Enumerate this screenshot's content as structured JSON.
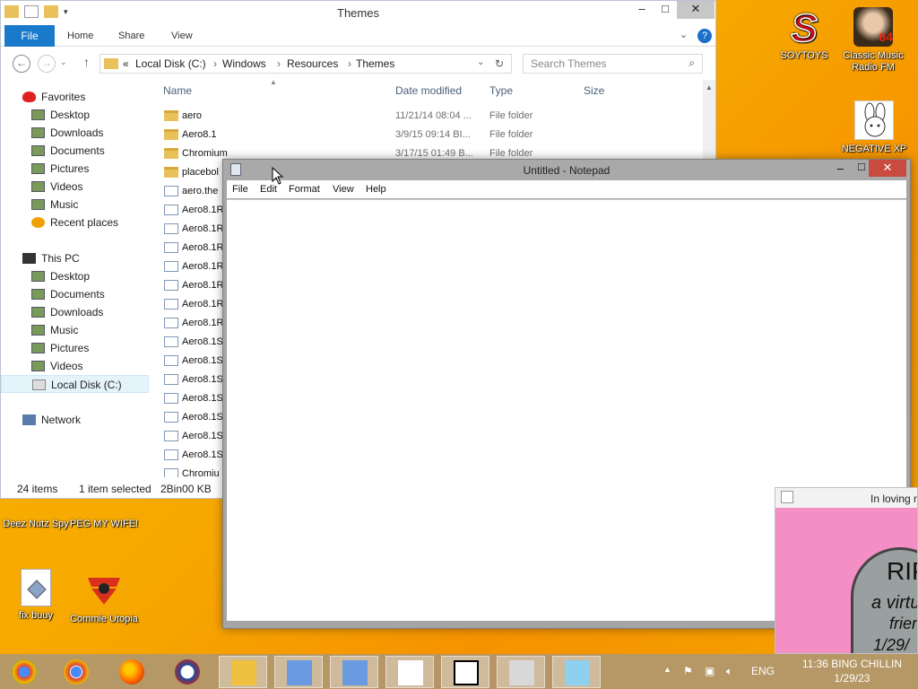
{
  "desktop_icons": [
    {
      "label": "SOYTOYS",
      "icon": "soytoys-s-icon"
    },
    {
      "label": "Classic Music Radio FM",
      "icon": "portrait-icon",
      "badge": "64"
    },
    {
      "label": "NEGATIVE XP",
      "icon": "bunny-icon"
    },
    {
      "label": "Deez Nutz Spy",
      "icon": "app-icon"
    },
    {
      "label": "PEG MY WIFE!",
      "icon": "app-icon"
    },
    {
      "label": "fix buuy",
      "icon": "script-file-icon"
    },
    {
      "label": "Commie Utopia",
      "icon": "emblem-icon"
    }
  ],
  "explorer": {
    "title": "Themes",
    "ribbon": {
      "file": "File",
      "home": "Home",
      "share": "Share",
      "view": "View"
    },
    "address": {
      "root": "«",
      "crumbs": [
        "Local Disk (C:)",
        "Windows",
        "Resources",
        "Themes"
      ]
    },
    "search_placeholder": "Search Themes",
    "columns": {
      "name": "Name",
      "date": "Date modified",
      "type": "Type",
      "size": "Size"
    },
    "nav": {
      "favorites": "Favorites",
      "fav_items": [
        "Desktop",
        "Downloads",
        "Documents",
        "Pictures",
        "Videos",
        "Music",
        "Recent places"
      ],
      "this_pc": "This PC",
      "pc_items": [
        "Desktop",
        "Documents",
        "Downloads",
        "Music",
        "Pictures",
        "Videos",
        "Local Disk (C:)"
      ],
      "network": "Network"
    },
    "rows": [
      {
        "name": "aero",
        "date": "11/21/14 08:04 ...",
        "type": "File folder",
        "kind": "folder"
      },
      {
        "name": "Aero8.1",
        "date": "3/9/15 09:14 BI...",
        "type": "File folder",
        "kind": "folder"
      },
      {
        "name": "Chromium",
        "date": "3/17/15 01:49 B...",
        "type": "File folder",
        "kind": "folder"
      },
      {
        "name": "placebol",
        "date": "",
        "type": "",
        "kind": "folder"
      },
      {
        "name": "aero.the",
        "date": "",
        "type": "",
        "kind": "file"
      },
      {
        "name": "Aero8.1R",
        "date": "",
        "type": "",
        "kind": "file"
      },
      {
        "name": "Aero8.1R",
        "date": "",
        "type": "",
        "kind": "file"
      },
      {
        "name": "Aero8.1R",
        "date": "",
        "type": "",
        "kind": "file"
      },
      {
        "name": "Aero8.1R",
        "date": "",
        "type": "",
        "kind": "file"
      },
      {
        "name": "Aero8.1R",
        "date": "",
        "type": "",
        "kind": "file"
      },
      {
        "name": "Aero8.1R",
        "date": "",
        "type": "",
        "kind": "file"
      },
      {
        "name": "Aero8.1R",
        "date": "",
        "type": "",
        "kind": "file"
      },
      {
        "name": "Aero8.1S",
        "date": "",
        "type": "",
        "kind": "file"
      },
      {
        "name": "Aero8.1S",
        "date": "",
        "type": "",
        "kind": "file"
      },
      {
        "name": "Aero8.1S",
        "date": "",
        "type": "",
        "kind": "file"
      },
      {
        "name": "Aero8.1S",
        "date": "",
        "type": "",
        "kind": "file"
      },
      {
        "name": "Aero8.1S",
        "date": "",
        "type": "",
        "kind": "file"
      },
      {
        "name": "Aero8.1S",
        "date": "",
        "type": "",
        "kind": "file"
      },
      {
        "name": "Aero8.1S",
        "date": "",
        "type": "",
        "kind": "file"
      },
      {
        "name": "Chromiu",
        "date": "",
        "type": "",
        "kind": "file"
      }
    ],
    "status": {
      "items": "24 items",
      "selected": "1 item selected",
      "size": "2Bin00 KB"
    }
  },
  "notepad": {
    "title": "Untitled - Notepad",
    "menu": [
      "File",
      "Edit",
      "Format",
      "View",
      "Help"
    ],
    "content": ""
  },
  "loving": {
    "title": "In loving m",
    "tomb_lines": [
      "RIP",
      "a virtu",
      "frien",
      "1/29/"
    ]
  },
  "taskbar": {
    "apps": [
      "chrome-alt-icon",
      "chrome-icon",
      "firefox-icon",
      "obama-icon",
      "explorer-icon",
      "network-computer-icon",
      "network-computer-icon",
      "bunny-icon",
      "7zip-icon",
      "cash-register-icon",
      "notepad-icon"
    ],
    "lang": "ENG",
    "time": "11:36 BING CHILLIN",
    "date": "1/29/23"
  }
}
